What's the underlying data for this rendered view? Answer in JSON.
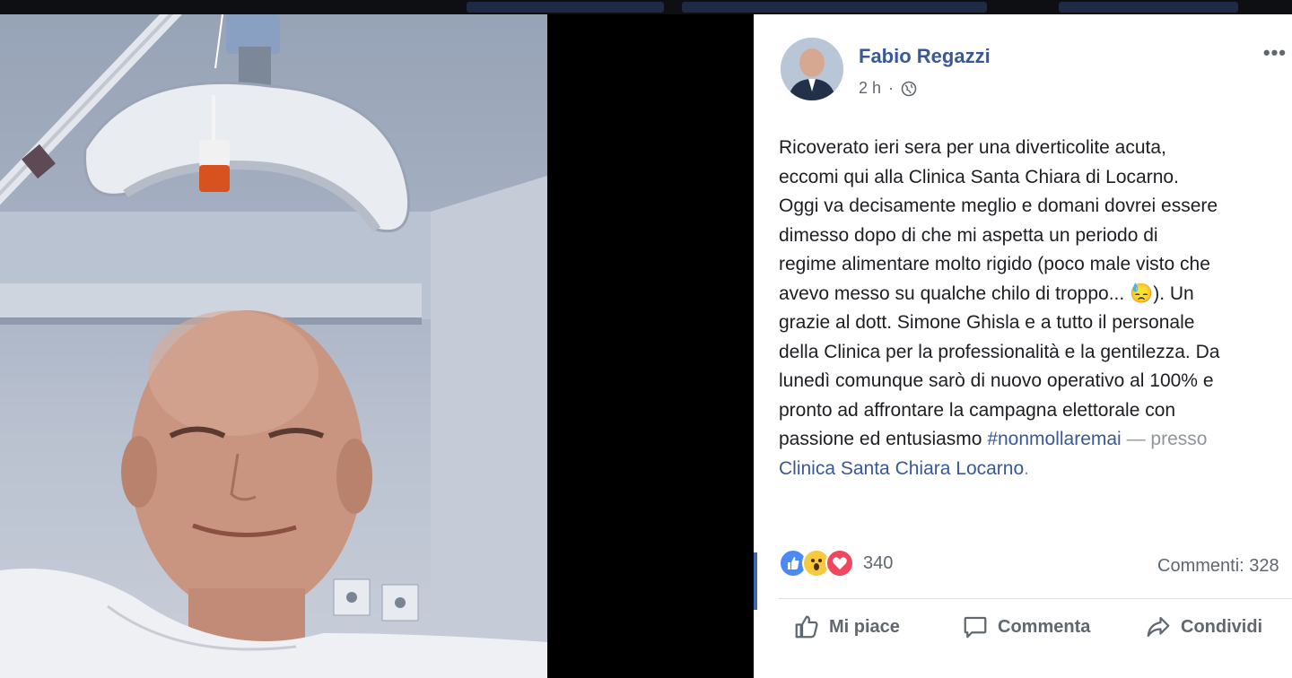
{
  "colors": {
    "brand_blue": "#385898",
    "like_blue": "#4a8af4",
    "wow_yellow": "#f7c93f",
    "love_red": "#f0465f",
    "meta_gray": "#606770"
  },
  "photo": {
    "subject": "hospital-selfie-photo"
  },
  "post": {
    "author": "Fabio Regazzi",
    "time": "2 h",
    "privacy_icon": "globe-icon",
    "more_label": "•••",
    "text": {
      "line1": "Ricoverato ieri sera per una diverticolite acuta,",
      "line2": "eccomi qui alla Clinica Santa Chiara di Locarno.",
      "line3": "Oggi va decisamente meglio e domani dovrei essere",
      "line4": "dimesso dopo di che mi aspetta un periodo di",
      "line5": "regime alimentare molto rigido (poco male visto che",
      "line6a": "avevo messo su qualche chilo di troppo... ",
      "emoji": "😓",
      "line6b": "). Un",
      "line7": "grazie al dott. Simone Ghisla e a tutto il personale",
      "line8": "della Clinica per la professionalità e la gentilezza. Da",
      "line9": "lunedì comunque sarò di nuovo operativo al 100% e",
      "line10": "pronto ad affrontare la campagna elettorale con",
      "line11a": "passione ed entusiasmo ",
      "hashtag": "#nonmollaremai",
      "presso": " — presso",
      "place": "Clinica Santa Chiara Locarno",
      "end": "."
    },
    "reactions": {
      "icons": [
        "like-reaction-icon",
        "wow-reaction-icon",
        "love-reaction-icon"
      ],
      "count": "340"
    },
    "comments_label": "Commenti: 328",
    "actions": {
      "like": "Mi piace",
      "comment": "Commenta",
      "share": "Condividi"
    }
  }
}
